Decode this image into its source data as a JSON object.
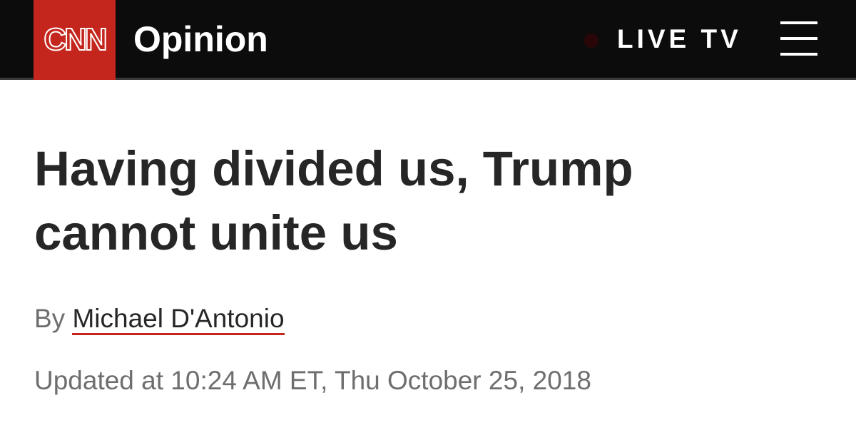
{
  "header": {
    "logo_text": "CNN",
    "section_title": "Opinion",
    "live_label": "LIVE TV",
    "menu_icon": "hamburger-menu-icon"
  },
  "article": {
    "headline": "Having divided us, Trump cannot unite us",
    "byline_prefix": "By",
    "author": "Michael D'Antonio",
    "updated": "Updated at 10:24 AM ET, Thu October 25, 2018"
  },
  "colors": {
    "brand_red": "#c4261d",
    "header_bg": "#0c0c0c",
    "headline_text": "#262626",
    "meta_text": "#6e6e6e"
  }
}
